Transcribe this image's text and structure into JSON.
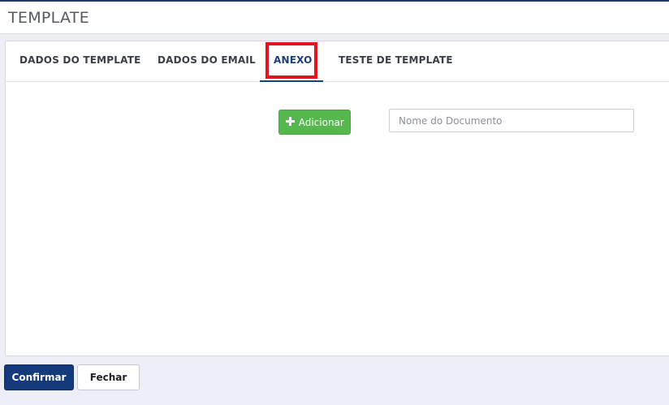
{
  "header": {
    "title": "TEMPLATE"
  },
  "tabs": [
    {
      "label": "DADOS DO TEMPLATE",
      "active": false
    },
    {
      "label": "DADOS DO EMAIL",
      "active": false
    },
    {
      "label": "ANEXO",
      "active": true
    },
    {
      "label": "TESTE DE TEMPLATE",
      "active": false
    }
  ],
  "anexo": {
    "add_button_label": "Adicionar",
    "add_button_icon": "plus-icon",
    "document_name_placeholder": "Nome do Documento",
    "document_name_value": ""
  },
  "footer": {
    "confirm_label": "Confirmar",
    "close_label": "Fechar"
  },
  "colors": {
    "accent": "#1c3f7a",
    "add_button": "#55b84d",
    "highlight": "#e3141e",
    "confirm_button": "#143a7c"
  }
}
